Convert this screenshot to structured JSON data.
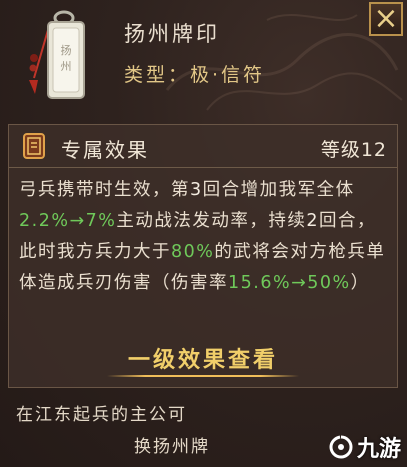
{
  "item": {
    "name": "扬州牌印",
    "type_line": "类型：极·信符",
    "icon": "jade-tablet-icon"
  },
  "close": {
    "label": "×"
  },
  "effect": {
    "badge_icon": "seal-badge-icon",
    "title": "专属效果",
    "level": "等级12",
    "desc": [
      {
        "t": "弓兵携带时生效，第"
      },
      {
        "t": "3",
        "c": "w"
      },
      {
        "t": "回合增加我军全体"
      },
      {
        "t": "2.2%→7%",
        "c": "g"
      },
      {
        "t": "主动战法发动率，持续"
      },
      {
        "t": "2",
        "c": "w"
      },
      {
        "t": "回合，此时我方兵力大于"
      },
      {
        "t": "80%",
        "c": "g"
      },
      {
        "t": "的武将会对方枪兵单体造成兵刃伤害（伤害率"
      },
      {
        "t": "15.6%→50%",
        "c": "g"
      },
      {
        "t": "）"
      }
    ],
    "view_button": "一级效果查看"
  },
  "lore": {
    "line1": "在江东起兵的主公可",
    "line2": "换扬州牌"
  },
  "watermark": {
    "text": "九游",
    "icon": "jiuyou-logo-icon"
  },
  "colors": {
    "highlight_green": "#6fc95a",
    "gold": "#f1cf6a",
    "type_gold": "#e2c787"
  }
}
